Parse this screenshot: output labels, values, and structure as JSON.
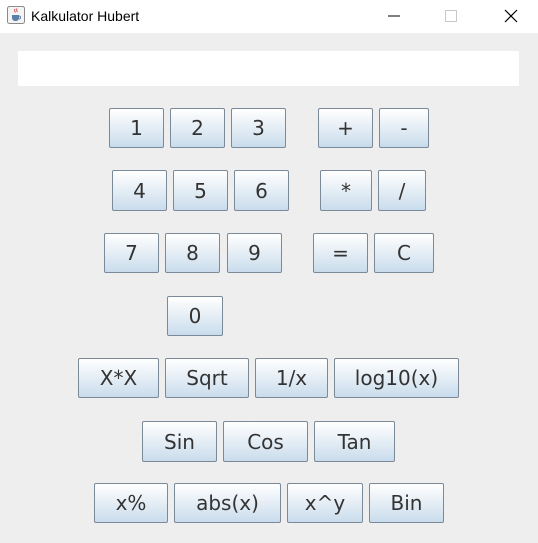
{
  "window": {
    "title": "Kalkulator Hubert",
    "app_icon": "java-cup-icon",
    "controls": {
      "minimize": "minimize-icon",
      "maximize": "maximize-icon",
      "close": "close-icon"
    }
  },
  "display": {
    "value": ""
  },
  "buttons": {
    "d1": "1",
    "d2": "2",
    "d3": "3",
    "plus": "+",
    "minus": "-",
    "d4": "4",
    "d5": "5",
    "d6": "6",
    "mul": "*",
    "div": "/",
    "d7": "7",
    "d8": "8",
    "d9": "9",
    "eq": "=",
    "clear": "C",
    "d0": "0",
    "square": "X*X",
    "sqrt": "Sqrt",
    "inverse": "1/x",
    "log10": "log10(x)",
    "sin": "Sin",
    "cos": "Cos",
    "tan": "Tan",
    "percent": "x%",
    "abs": "abs(x)",
    "power": "x^y",
    "bin": "Bin"
  }
}
